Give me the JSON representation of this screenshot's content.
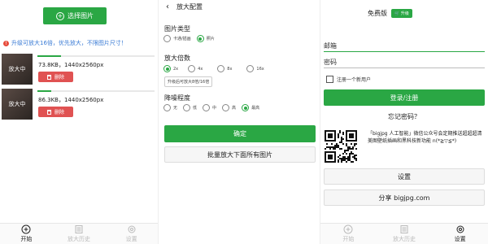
{
  "screen1": {
    "choose_button": "选择图片",
    "notice": "升级可放大16倍，优先放大，不限图片尺寸！",
    "items": [
      {
        "thumb_label": "放大中",
        "info": "73.8KB，1440x2560px",
        "delete": "删除",
        "progress": 0.2
      },
      {
        "thumb_label": "放大中",
        "info": "86.3KB，1440x2560px",
        "delete": "删除",
        "progress": 0.12
      }
    ],
    "tabs": [
      "开始",
      "放大历史",
      "设置"
    ]
  },
  "screen2": {
    "title": "放大配置",
    "image_type_label": "图片类型",
    "image_types": [
      {
        "label": "卡通/插画",
        "selected": false
      },
      {
        "label": "照片",
        "selected": true
      }
    ],
    "scale_label": "放大倍数",
    "scales": [
      {
        "label": "2x",
        "selected": true
      },
      {
        "label": "4x",
        "selected": false
      },
      {
        "label": "8x",
        "selected": false
      },
      {
        "label": "16x",
        "selected": false
      }
    ],
    "upgrade_hint": "升级后可放大8倍/16倍",
    "noise_label": "降噪程度",
    "noise_levels": [
      {
        "label": "无",
        "selected": false
      },
      {
        "label": "低",
        "selected": false
      },
      {
        "label": "中",
        "selected": false
      },
      {
        "label": "高",
        "selected": false
      },
      {
        "label": "最高",
        "selected": true
      }
    ],
    "confirm": "确定",
    "batch": "批量放大下面所有图片"
  },
  "screen3": {
    "plan": "免费版",
    "upgrade": "升级",
    "email": "邮箱",
    "password": "密码",
    "register_checkbox": "注册一个新用户",
    "login": "登录/注册",
    "forgot": "忘记密码？",
    "promo": "「bigjpg 人工智能」微信公众号会定期推送超超超清美图壁纸插画和黑科技新功能 n(*≧▽≦*)",
    "settings": "设置",
    "share": "分享 bigjpg.com",
    "tabs": [
      "开始",
      "放大历史",
      "设置"
    ]
  },
  "colors": {
    "accent": "#2aa744",
    "danger": "#e05252",
    "link": "#3a7bd5"
  }
}
